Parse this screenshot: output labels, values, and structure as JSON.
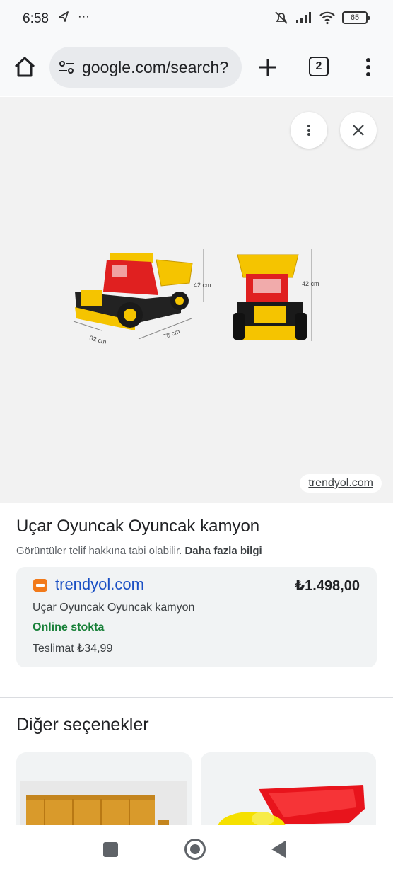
{
  "status_bar": {
    "time": "6:58",
    "extra_icons": "⋯",
    "battery": "65",
    "icons": [
      "location-icon",
      "mute-icon",
      "signal-icon",
      "wifi-icon",
      "battery-icon"
    ]
  },
  "browser": {
    "url": "google.com/search?",
    "tab_count": "2"
  },
  "viewer": {
    "image_labels": {
      "height_left": "42 cm",
      "height_right": "42 cm",
      "width": "32 cm",
      "length": "78 cm"
    },
    "source": "trendyol.com"
  },
  "result": {
    "title": "Uçar Oyuncak Oyuncak kamyon",
    "copyright_text": "Görüntüler telif hakkına tabi olabilir.",
    "more_info": "Daha fazla bilgi"
  },
  "product_card": {
    "site": "trendyol.com",
    "price": "₺1.498,00",
    "name": "Uçar Oyuncak Oyuncak kamyon",
    "stock": "Online stokta",
    "delivery": "Teslimat ₺34,99"
  },
  "other_options": {
    "title": "Diğer seçenekler"
  },
  "colors": {
    "accent_link": "#1a4fc4",
    "stock_green": "#188038",
    "truck_yellow": "#f5c400",
    "truck_red": "#e02020",
    "brand_orange": "#f27a1a"
  }
}
